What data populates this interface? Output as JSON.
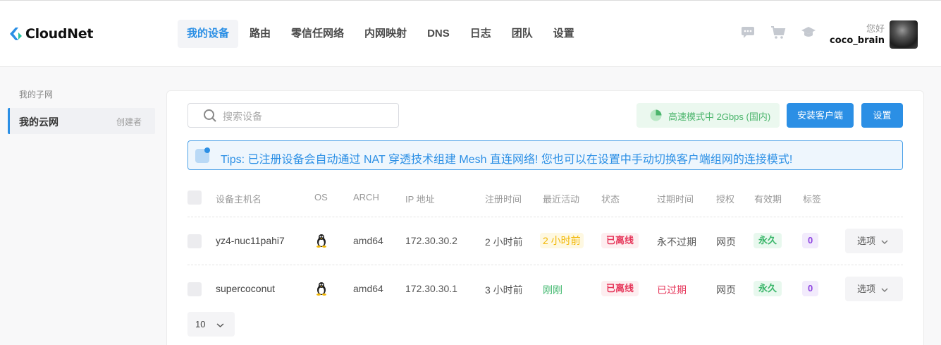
{
  "header": {
    "brand": "CloudNet",
    "nav": [
      {
        "label": "我的设备",
        "active": true
      },
      {
        "label": "路由"
      },
      {
        "label": "零信任网络"
      },
      {
        "label": "内网映射"
      },
      {
        "label": "DNS"
      },
      {
        "label": "日志"
      },
      {
        "label": "团队"
      },
      {
        "label": "设置"
      }
    ],
    "icons": [
      "chat-icon",
      "cart-icon",
      "graduation-cap-icon"
    ],
    "greeting": "您好",
    "username": "coco_brain"
  },
  "sidebar": {
    "title": "我的子网",
    "items": [
      {
        "label": "我的云网",
        "badge": "创建者"
      }
    ]
  },
  "toolbar": {
    "search_placeholder": "搜索设备",
    "speed_label": "高速模式中 2Gbps (国内)",
    "install_button": "安装客户端",
    "settings_button": "设置"
  },
  "tips": "Tips: 已注册设备会自动通过 NAT 穿透技术组建 Mesh 直连网络! 您也可以在设置中手动切换客户端组网的连接模式!",
  "table": {
    "columns": [
      "设备主机名",
      "OS",
      "ARCH",
      "IP 地址",
      "注册时间",
      "最近活动",
      "状态",
      "过期时间",
      "授权",
      "有效期",
      "标签"
    ],
    "rows": [
      {
        "host": "yz4-nuc11pahi7",
        "os": "linux",
        "arch": "amd64",
        "ip": "172.30.30.2",
        "registered": "2 小时前",
        "last_active": "2 小时前",
        "status": "已离线",
        "expires": "永不过期",
        "auth": "网页",
        "validity": "永久",
        "tags": "0",
        "options": "选项"
      },
      {
        "host": "supercoconut",
        "os": "linux",
        "arch": "amd64",
        "ip": "172.30.30.1",
        "registered": "3 小时前",
        "last_active": "刚刚",
        "status": "已离线",
        "expires": "已过期",
        "auth": "网页",
        "validity": "永久",
        "tags": "0",
        "options": "选项"
      }
    ]
  },
  "pagination": {
    "page_size": "10"
  },
  "colors": {
    "accent": "#2b8fe5",
    "success": "#3bb66a",
    "danger": "#e6365a",
    "warning": "#f2b705",
    "tag": "#8e44e0"
  }
}
